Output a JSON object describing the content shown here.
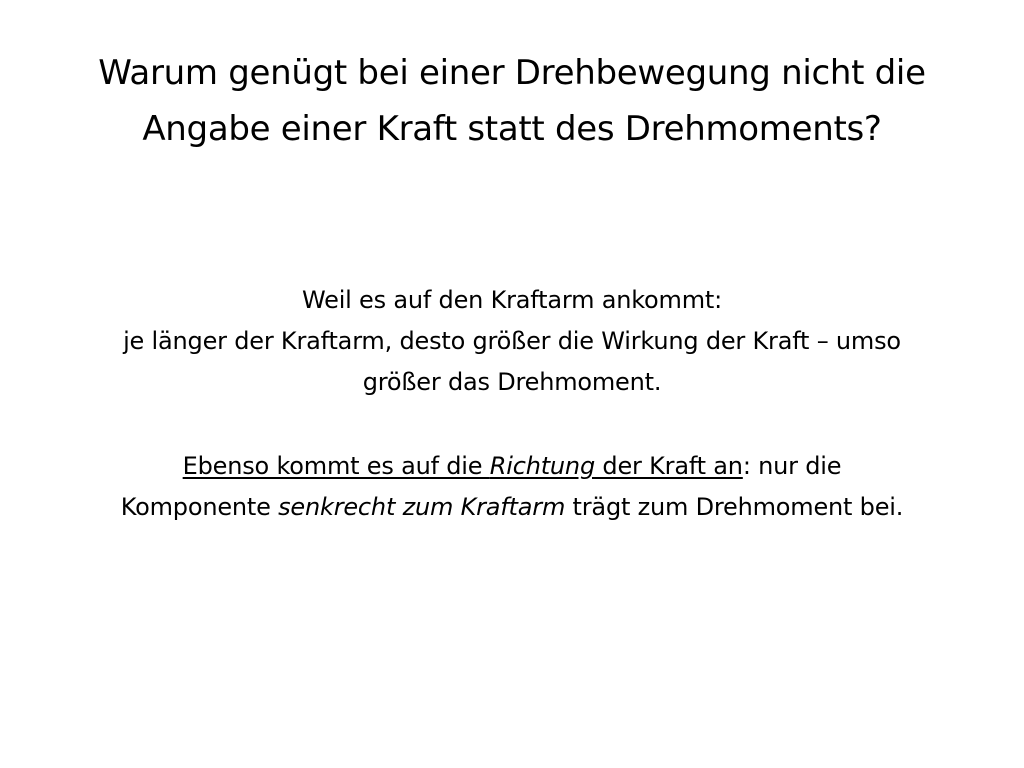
{
  "slide": {
    "title_lines": [
      "Warum genügt bei einer Drehbewegung nicht die",
      "Angabe einer Kraft statt des Drehmoments?"
    ],
    "paragraph1_lines": [
      "Weil es auf den Kraftarm ankommt:",
      "je länger der Kraftarm, desto größer die Wirkung der Kraft – umso",
      "größer das Drehmoment."
    ],
    "paragraph2": {
      "u1": "Ebenso kommt es auf die ",
      "u_italic": "Richtung",
      "u2": " der Kraft an",
      "t1": ": nur die",
      "t2": "Komponente ",
      "italic": "senkrecht zum Kraftarm",
      "t3": " trägt zum Drehmoment bei."
    }
  }
}
